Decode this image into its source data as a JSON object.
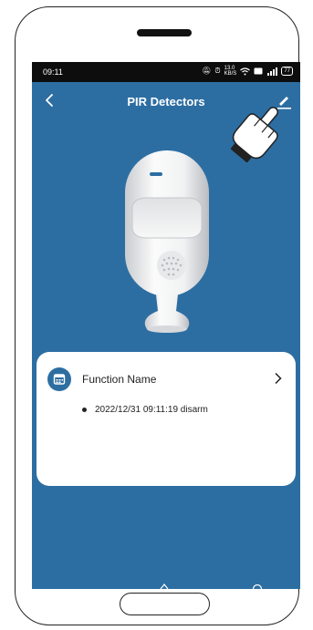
{
  "status_bar": {
    "time": "09:11",
    "speed": "13.0\nKB/S",
    "battery": "77"
  },
  "header": {
    "title": "PIR Detectors"
  },
  "card": {
    "function_label": "Function Name",
    "log_entries": [
      {
        "text": "2022/12/31 09:11:19 disarm"
      }
    ]
  },
  "colors": {
    "screen_background": "#2d6ea2",
    "status_bar": "#0d0d0d",
    "card_background": "#ffffff"
  },
  "icons": {
    "back": "chevron-left-icon",
    "edit": "pencil-icon",
    "function": "calendar-icon",
    "open": "chevron-right-icon"
  }
}
